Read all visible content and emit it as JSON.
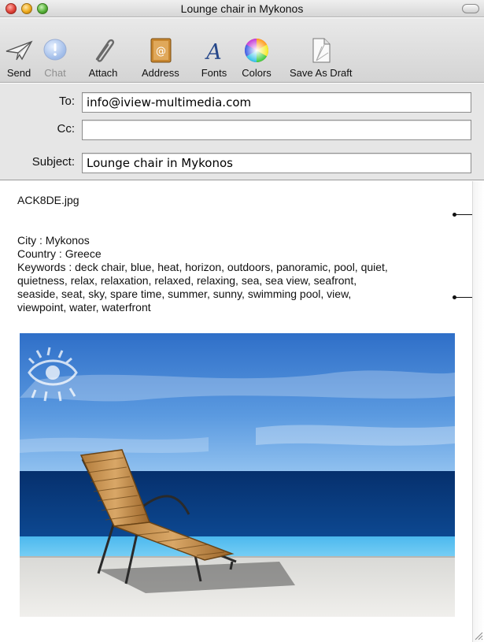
{
  "window": {
    "title": "Lounge chair in Mykonos"
  },
  "toolbar": {
    "buttons": [
      {
        "label": "Send",
        "icon": "send-icon",
        "enabled": true
      },
      {
        "label": "Chat",
        "icon": "chat-icon",
        "enabled": false
      },
      {
        "label": "Attach",
        "icon": "paperclip-icon",
        "enabled": true
      },
      {
        "label": "Address",
        "icon": "address-book-icon",
        "enabled": true
      },
      {
        "label": "Fonts",
        "icon": "fonts-icon",
        "enabled": true
      },
      {
        "label": "Colors",
        "icon": "color-wheel-icon",
        "enabled": true
      },
      {
        "label": "Save As Draft",
        "icon": "draft-document-icon",
        "enabled": true
      }
    ]
  },
  "headers": {
    "to_label": "To:",
    "to_value": "info@iview-multimedia.com",
    "cc_label": "Cc:",
    "cc_value": "",
    "subject_label": "Subject:",
    "subject_value": "Lounge chair in Mykonos"
  },
  "message": {
    "filename": "ACK8DE.jpg",
    "city": "City : Mykonos",
    "country": "Country : Greece",
    "keywords_lines": [
      "Keywords : deck chair, blue, heat, horizon, outdoors, panoramic, pool, quiet,",
      "quietness, relax, relaxation, relaxed, relaxing, sea, sea view, seafront,",
      "seaside, seat, sky, spare time, summer, sunny, swimming pool, view,",
      "viewpoint, water, waterfront"
    ],
    "attachment_icon": "sun-eye-watermark-icon"
  },
  "colors": {
    "sky": "#3f7fd0",
    "sea": "#0a3a7a",
    "pool": "#5ec0ef",
    "deck": "#e8e8e6"
  }
}
